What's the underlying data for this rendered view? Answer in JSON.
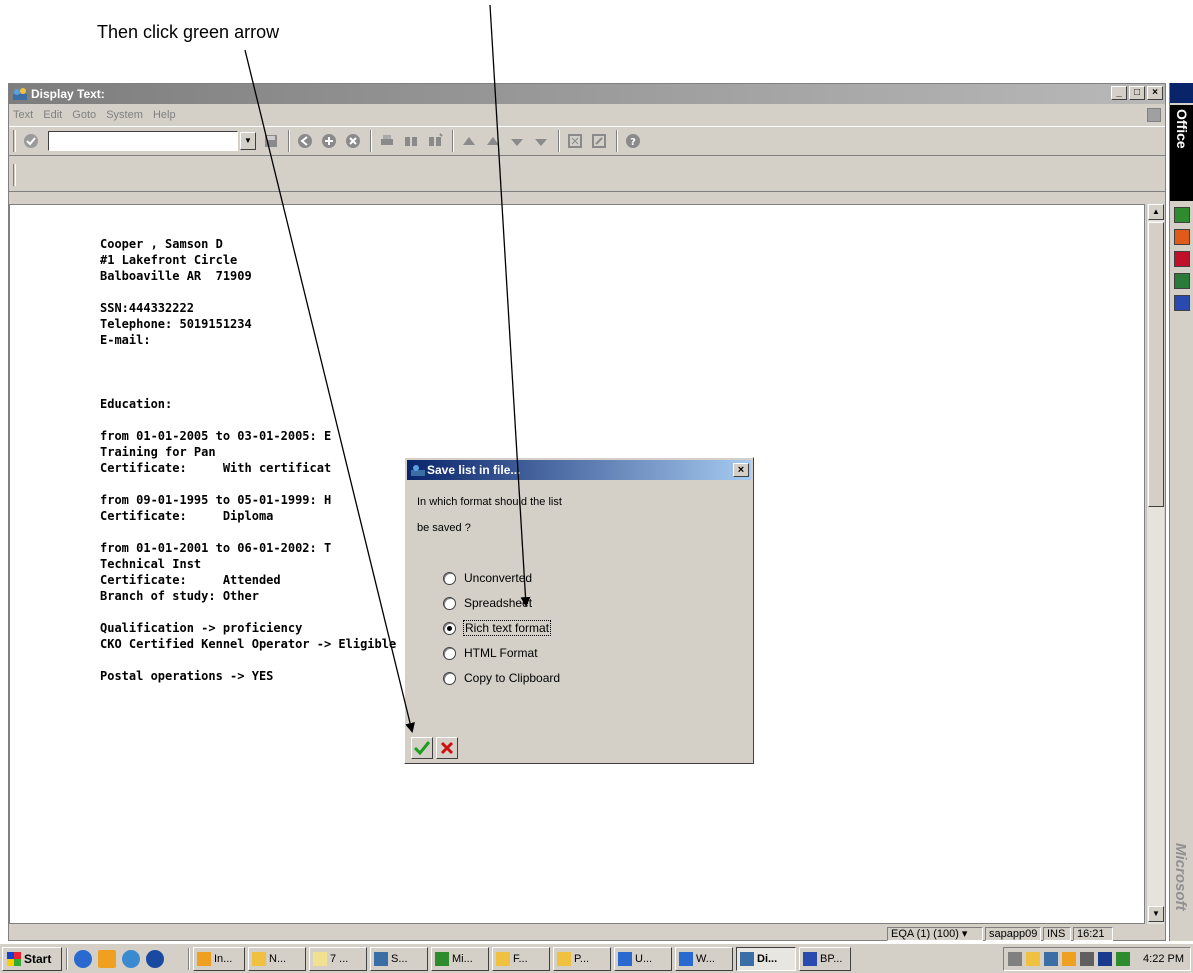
{
  "annotation": {
    "text": "Then click green arrow"
  },
  "window": {
    "title": "Display Text:",
    "controls": [
      "_",
      "□",
      "×"
    ],
    "menu": [
      "Text",
      "Edit",
      "Goto",
      "System",
      "Help"
    ]
  },
  "document": {
    "text": "Cooper , Samson D\n#1 Lakefront Circle\nBalboaville AR  71909\n\nSSN:444332222\nTelephone: 5019151234\nE-mail:\n\n\n\nEducation:\n\nfrom 01-01-2005 to 03-01-2005: E\nTraining for Pan\nCertificate:     With certificat\n\nfrom 09-01-1995 to 05-01-1999: H\nCertificate:     Diploma\n\nfrom 01-01-2001 to 06-01-2002: T\nTechnical Inst\nCertificate:     Attended\nBranch of study: Other\n\nQualification -> proficiency\nCKO Certified Kennel Operator -> Eligible to apply\n\nPostal operations -> YES"
  },
  "dialog": {
    "title": "Save list in file...",
    "question_line1": "In which format should the list",
    "question_line2": "be saved ?",
    "options": [
      {
        "label": "Unconverted",
        "selected": false
      },
      {
        "label": "Spreadsheet",
        "selected": false
      },
      {
        "label": "Rich text format",
        "selected": true
      },
      {
        "label": "HTML Format",
        "selected": false
      },
      {
        "label": "Copy to Clipboard",
        "selected": false
      }
    ],
    "close": "×"
  },
  "statusbar": {
    "system": "EQA (1) (100) ▾",
    "server": "sapapp09",
    "mode": "INS",
    "time": "16:21"
  },
  "officebar": {
    "label": "Office",
    "brand": "Microsoft"
  },
  "taskbar": {
    "start": "Start",
    "buttons": [
      "In...",
      "N...",
      "7 ...",
      "S...",
      "Mi...",
      "F...",
      "P...",
      "U...",
      "W...",
      "Di...",
      "BP..."
    ],
    "clock": "4:22 PM"
  },
  "colors": {
    "accent_green": "#1e9e1e",
    "cancel_red": "#cc1111",
    "dialog_title": "#0a246a"
  }
}
